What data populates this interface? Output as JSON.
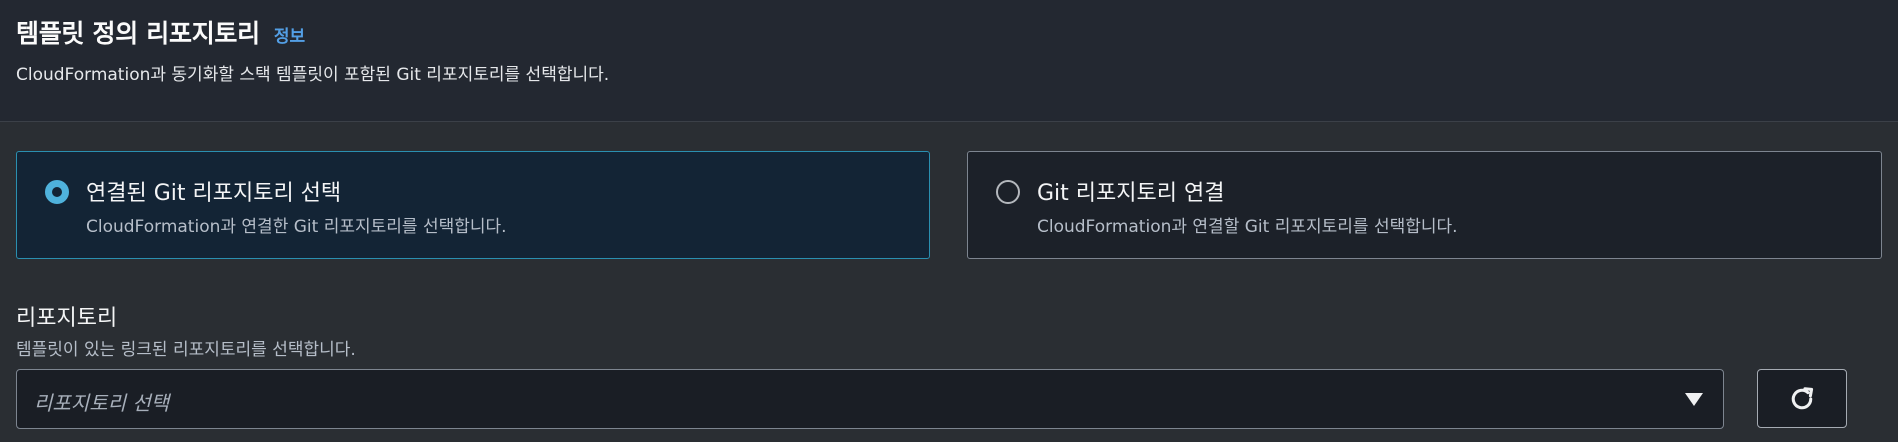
{
  "header": {
    "title": "템플릿 정의 리포지토리",
    "info_link": "정보",
    "description": "CloudFormation과 동기화할 스택 템플릿이 포함된 Git 리포지토리를 선택합니다."
  },
  "options": [
    {
      "label": "연결된 Git 리포지토리 선택",
      "description": "CloudFormation과 연결한 Git 리포지토리를 선택합니다.",
      "selected": true
    },
    {
      "label": "Git 리포지토리 연결",
      "description": "CloudFormation과 연결할 Git 리포지토리를 선택합니다.",
      "selected": false
    }
  ],
  "repository_field": {
    "label": "리포지토리",
    "description": "템플릿이 있는 링크된 리포지토리를 선택합니다.",
    "placeholder": "리포지토리 선택"
  },
  "icons": {
    "dropdown": "caret-down-icon",
    "refresh": "refresh-icon"
  },
  "colors": {
    "accent": "#4fb2dc",
    "link": "#539fe5",
    "selected_tile_bg": "#132435"
  }
}
